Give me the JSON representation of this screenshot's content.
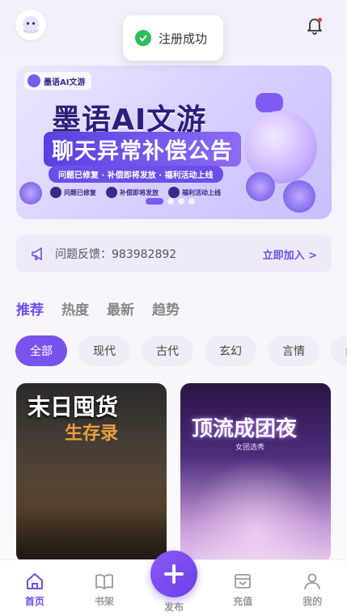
{
  "toast": {
    "message": "注册成功"
  },
  "banner": {
    "brand": "墨语AI文游",
    "headline": "墨语AI文游",
    "subheadline": "聊天异常补偿公告",
    "tagline": "问题已修复 · 补偿即将发放 · 福利活动上线",
    "features": [
      "问题已修复",
      "补偿即将发放",
      "福利活动上线"
    ],
    "page_count": 4,
    "active_page": 0
  },
  "feedback": {
    "text": "问题反馈：983982892",
    "join": "立即加入 >"
  },
  "tabs": [
    "推荐",
    "热度",
    "最新",
    "趋势"
  ],
  "chips": [
    "全部",
    "现代",
    "古代",
    "玄幻",
    "言情",
    "纟"
  ],
  "cards": [
    {
      "title": "末日囤货",
      "subtitle": "生存录"
    },
    {
      "title": "顶流成团夜",
      "subtitle": "女团选秀"
    }
  ],
  "nav": {
    "home": "首页",
    "shelf": "书架",
    "publish": "发布",
    "recharge": "充值",
    "mine": "我的"
  },
  "colors": {
    "accent": "#6d4ef0",
    "success": "#2fbe5a"
  }
}
